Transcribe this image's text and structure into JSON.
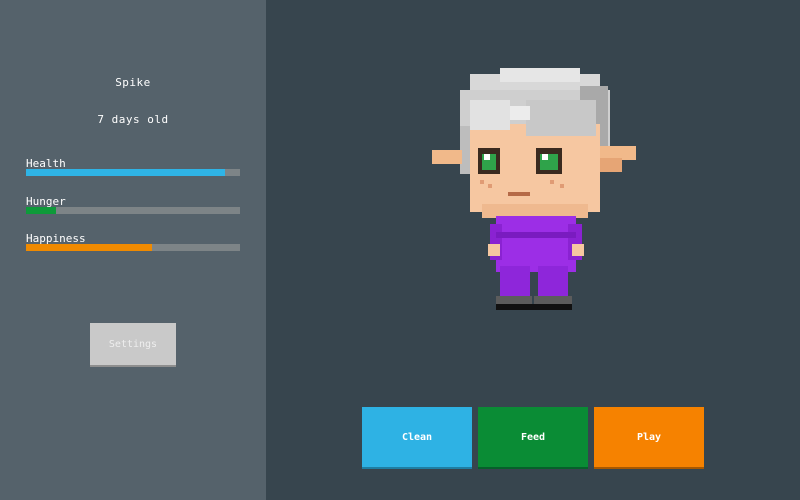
{
  "pet": {
    "name": "Spike",
    "age": "7 days old"
  },
  "stats": [
    {
      "label": "Health",
      "value": 0.93,
      "color": "#2fb4e6"
    },
    {
      "label": "Hunger",
      "value": 0.14,
      "color": "#0e9a3a"
    },
    {
      "label": "Happiness",
      "value": 0.59,
      "color": "#f08a00"
    }
  ],
  "settings": {
    "label": "Settings"
  },
  "actions": [
    {
      "label": "Clean",
      "color": "#2eb2e4",
      "shadow": "#1e7ea3"
    },
    {
      "label": "Feed",
      "color": "#0a8c35",
      "shadow": "#06602a"
    },
    {
      "label": "Play",
      "color": "#f68200",
      "shadow": "#a85800"
    }
  ],
  "sprite": {
    "icon": "elf-pet-sprite"
  }
}
